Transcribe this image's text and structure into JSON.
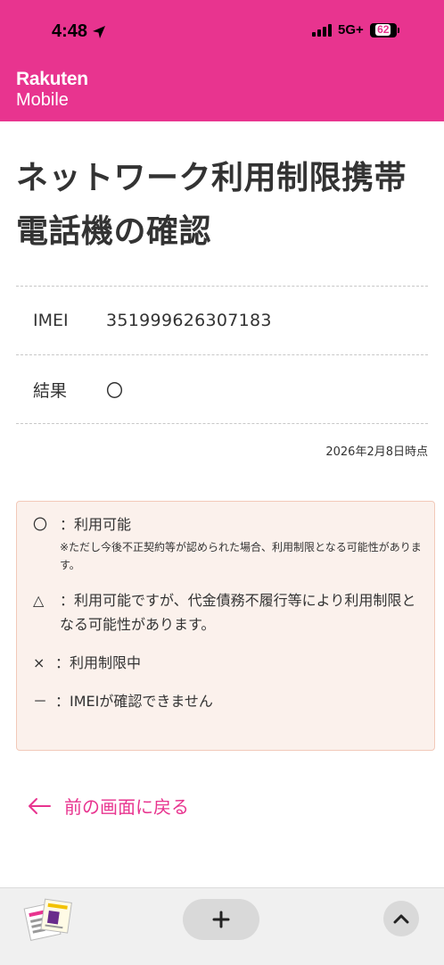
{
  "status_bar": {
    "time": "4:48",
    "network": "5G+",
    "battery": "62"
  },
  "brand": {
    "line1": "Rakuten",
    "line2": "Mobile"
  },
  "page": {
    "title": "ネットワーク利用制限携帯電話機の確認"
  },
  "result_table": {
    "rows": [
      {
        "label": "IMEI",
        "value": "351999626307183"
      },
      {
        "label": "結果",
        "value": "〇"
      }
    ]
  },
  "timestamp": "2026年2月8日時点",
  "legend": {
    "items": [
      {
        "symbol": "〇",
        "text": "：利用可能",
        "note": "※ただし今後不正契約等が認められた場合、利用制限となる可能性があります。"
      },
      {
        "symbol": "△",
        "text": "：利用可能ですが、代金債務不履行等により利用制限となる可能性があります。"
      },
      {
        "symbol": "×",
        "text": "：利用制限中"
      },
      {
        "symbol": "－",
        "text": "：IMEIが確認できません"
      }
    ]
  },
  "back_link": {
    "label": "前の画面に戻る"
  },
  "icons": {
    "location": "location-arrow-icon",
    "signal": "signal-icon",
    "battery": "battery-icon",
    "back": "arrow-left-icon",
    "new_tab": "plus-icon",
    "scroll_up": "chevron-up-icon"
  },
  "colors": {
    "brand": "#e8348f",
    "legend_bg": "#fbf1ec",
    "legend_border": "#f2c9b9",
    "text": "#333333"
  }
}
